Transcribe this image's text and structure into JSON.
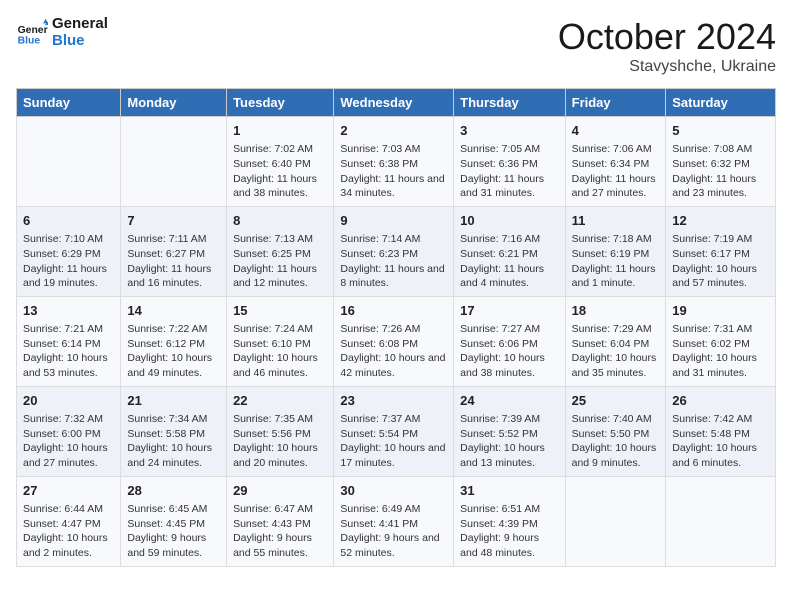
{
  "header": {
    "logo_general": "General",
    "logo_blue": "Blue",
    "month": "October 2024",
    "location": "Stavyshche, Ukraine"
  },
  "days_of_week": [
    "Sunday",
    "Monday",
    "Tuesday",
    "Wednesday",
    "Thursday",
    "Friday",
    "Saturday"
  ],
  "weeks": [
    [
      {
        "day": "",
        "info": ""
      },
      {
        "day": "",
        "info": ""
      },
      {
        "day": "1",
        "info": "Sunrise: 7:02 AM\nSunset: 6:40 PM\nDaylight: 11 hours and 38 minutes."
      },
      {
        "day": "2",
        "info": "Sunrise: 7:03 AM\nSunset: 6:38 PM\nDaylight: 11 hours and 34 minutes."
      },
      {
        "day": "3",
        "info": "Sunrise: 7:05 AM\nSunset: 6:36 PM\nDaylight: 11 hours and 31 minutes."
      },
      {
        "day": "4",
        "info": "Sunrise: 7:06 AM\nSunset: 6:34 PM\nDaylight: 11 hours and 27 minutes."
      },
      {
        "day": "5",
        "info": "Sunrise: 7:08 AM\nSunset: 6:32 PM\nDaylight: 11 hours and 23 minutes."
      }
    ],
    [
      {
        "day": "6",
        "info": "Sunrise: 7:10 AM\nSunset: 6:29 PM\nDaylight: 11 hours and 19 minutes."
      },
      {
        "day": "7",
        "info": "Sunrise: 7:11 AM\nSunset: 6:27 PM\nDaylight: 11 hours and 16 minutes."
      },
      {
        "day": "8",
        "info": "Sunrise: 7:13 AM\nSunset: 6:25 PM\nDaylight: 11 hours and 12 minutes."
      },
      {
        "day": "9",
        "info": "Sunrise: 7:14 AM\nSunset: 6:23 PM\nDaylight: 11 hours and 8 minutes."
      },
      {
        "day": "10",
        "info": "Sunrise: 7:16 AM\nSunset: 6:21 PM\nDaylight: 11 hours and 4 minutes."
      },
      {
        "day": "11",
        "info": "Sunrise: 7:18 AM\nSunset: 6:19 PM\nDaylight: 11 hours and 1 minute."
      },
      {
        "day": "12",
        "info": "Sunrise: 7:19 AM\nSunset: 6:17 PM\nDaylight: 10 hours and 57 minutes."
      }
    ],
    [
      {
        "day": "13",
        "info": "Sunrise: 7:21 AM\nSunset: 6:14 PM\nDaylight: 10 hours and 53 minutes."
      },
      {
        "day": "14",
        "info": "Sunrise: 7:22 AM\nSunset: 6:12 PM\nDaylight: 10 hours and 49 minutes."
      },
      {
        "day": "15",
        "info": "Sunrise: 7:24 AM\nSunset: 6:10 PM\nDaylight: 10 hours and 46 minutes."
      },
      {
        "day": "16",
        "info": "Sunrise: 7:26 AM\nSunset: 6:08 PM\nDaylight: 10 hours and 42 minutes."
      },
      {
        "day": "17",
        "info": "Sunrise: 7:27 AM\nSunset: 6:06 PM\nDaylight: 10 hours and 38 minutes."
      },
      {
        "day": "18",
        "info": "Sunrise: 7:29 AM\nSunset: 6:04 PM\nDaylight: 10 hours and 35 minutes."
      },
      {
        "day": "19",
        "info": "Sunrise: 7:31 AM\nSunset: 6:02 PM\nDaylight: 10 hours and 31 minutes."
      }
    ],
    [
      {
        "day": "20",
        "info": "Sunrise: 7:32 AM\nSunset: 6:00 PM\nDaylight: 10 hours and 27 minutes."
      },
      {
        "day": "21",
        "info": "Sunrise: 7:34 AM\nSunset: 5:58 PM\nDaylight: 10 hours and 24 minutes."
      },
      {
        "day": "22",
        "info": "Sunrise: 7:35 AM\nSunset: 5:56 PM\nDaylight: 10 hours and 20 minutes."
      },
      {
        "day": "23",
        "info": "Sunrise: 7:37 AM\nSunset: 5:54 PM\nDaylight: 10 hours and 17 minutes."
      },
      {
        "day": "24",
        "info": "Sunrise: 7:39 AM\nSunset: 5:52 PM\nDaylight: 10 hours and 13 minutes."
      },
      {
        "day": "25",
        "info": "Sunrise: 7:40 AM\nSunset: 5:50 PM\nDaylight: 10 hours and 9 minutes."
      },
      {
        "day": "26",
        "info": "Sunrise: 7:42 AM\nSunset: 5:48 PM\nDaylight: 10 hours and 6 minutes."
      }
    ],
    [
      {
        "day": "27",
        "info": "Sunrise: 6:44 AM\nSunset: 4:47 PM\nDaylight: 10 hours and 2 minutes."
      },
      {
        "day": "28",
        "info": "Sunrise: 6:45 AM\nSunset: 4:45 PM\nDaylight: 9 hours and 59 minutes."
      },
      {
        "day": "29",
        "info": "Sunrise: 6:47 AM\nSunset: 4:43 PM\nDaylight: 9 hours and 55 minutes."
      },
      {
        "day": "30",
        "info": "Sunrise: 6:49 AM\nSunset: 4:41 PM\nDaylight: 9 hours and 52 minutes."
      },
      {
        "day": "31",
        "info": "Sunrise: 6:51 AM\nSunset: 4:39 PM\nDaylight: 9 hours and 48 minutes."
      },
      {
        "day": "",
        "info": ""
      },
      {
        "day": "",
        "info": ""
      }
    ]
  ]
}
